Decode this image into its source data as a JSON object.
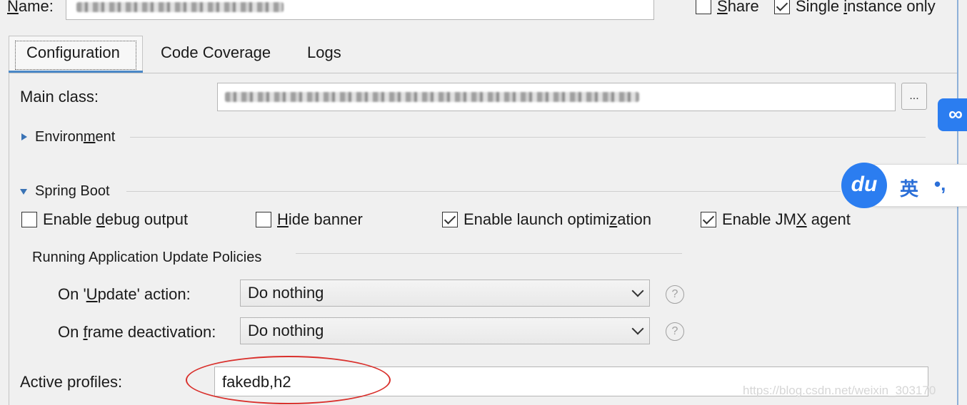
{
  "header": {
    "name_label_pre": "",
    "name_label_mnemonic": "N",
    "name_label_post": "ame:",
    "share": {
      "label_mnemonic": "S",
      "label_post": "hare",
      "checked": false
    },
    "single_instance": {
      "label_pre": "Single ",
      "label_mnemonic": "i",
      "label_post": "nstance only",
      "checked": true
    }
  },
  "tabs": [
    {
      "label": "Configuration",
      "active": true
    },
    {
      "label": "Code Coverage",
      "active": false
    },
    {
      "label": "Logs",
      "active": false
    }
  ],
  "config": {
    "main_class_label": "Main class:",
    "browse_label": "...",
    "environment": {
      "pre": "Environ",
      "mnemonic": "m",
      "post": "ent",
      "expanded": false
    },
    "spring_boot": {
      "pre": "Sprin",
      "mnemonic": "g",
      "post": " Boot",
      "expanded": true
    },
    "checkboxes": [
      {
        "pre": "Enable ",
        "mnemonic": "d",
        "post": "ebug output",
        "checked": false
      },
      {
        "pre": "",
        "mnemonic": "H",
        "post": "ide banner",
        "checked": false
      },
      {
        "pre": "Enable launch optimi",
        "mnemonic": "z",
        "post": "ation",
        "checked": true
      },
      {
        "pre": "Enable JM",
        "mnemonic": "X",
        "post": " agent",
        "checked": true
      }
    ],
    "update_policies_title": "Running Application Update Policies",
    "on_update": {
      "pre": "On '",
      "mnemonic": "U",
      "post": "pdate' action:",
      "value": "Do nothing",
      "help": "?"
    },
    "on_frame": {
      "pre": "On ",
      "mnemonic": "f",
      "post": "rame deactivation:",
      "value": "Do nothing",
      "help": "?"
    },
    "active_profiles_label": "Active profiles:",
    "active_profiles_value": "fakedb,h2"
  },
  "overlay": {
    "baidu_link_icon": "link-icon",
    "baidu_logo_text": "du",
    "baidu_lang_text": "英",
    "baidu_punct_text": "•,",
    "watermark": "https://blog.csdn.net/weixin_303170"
  },
  "colors": {
    "accent": "#4a88c7",
    "annotation": "#d9302c",
    "baidu_blue": "#2b7df0"
  }
}
